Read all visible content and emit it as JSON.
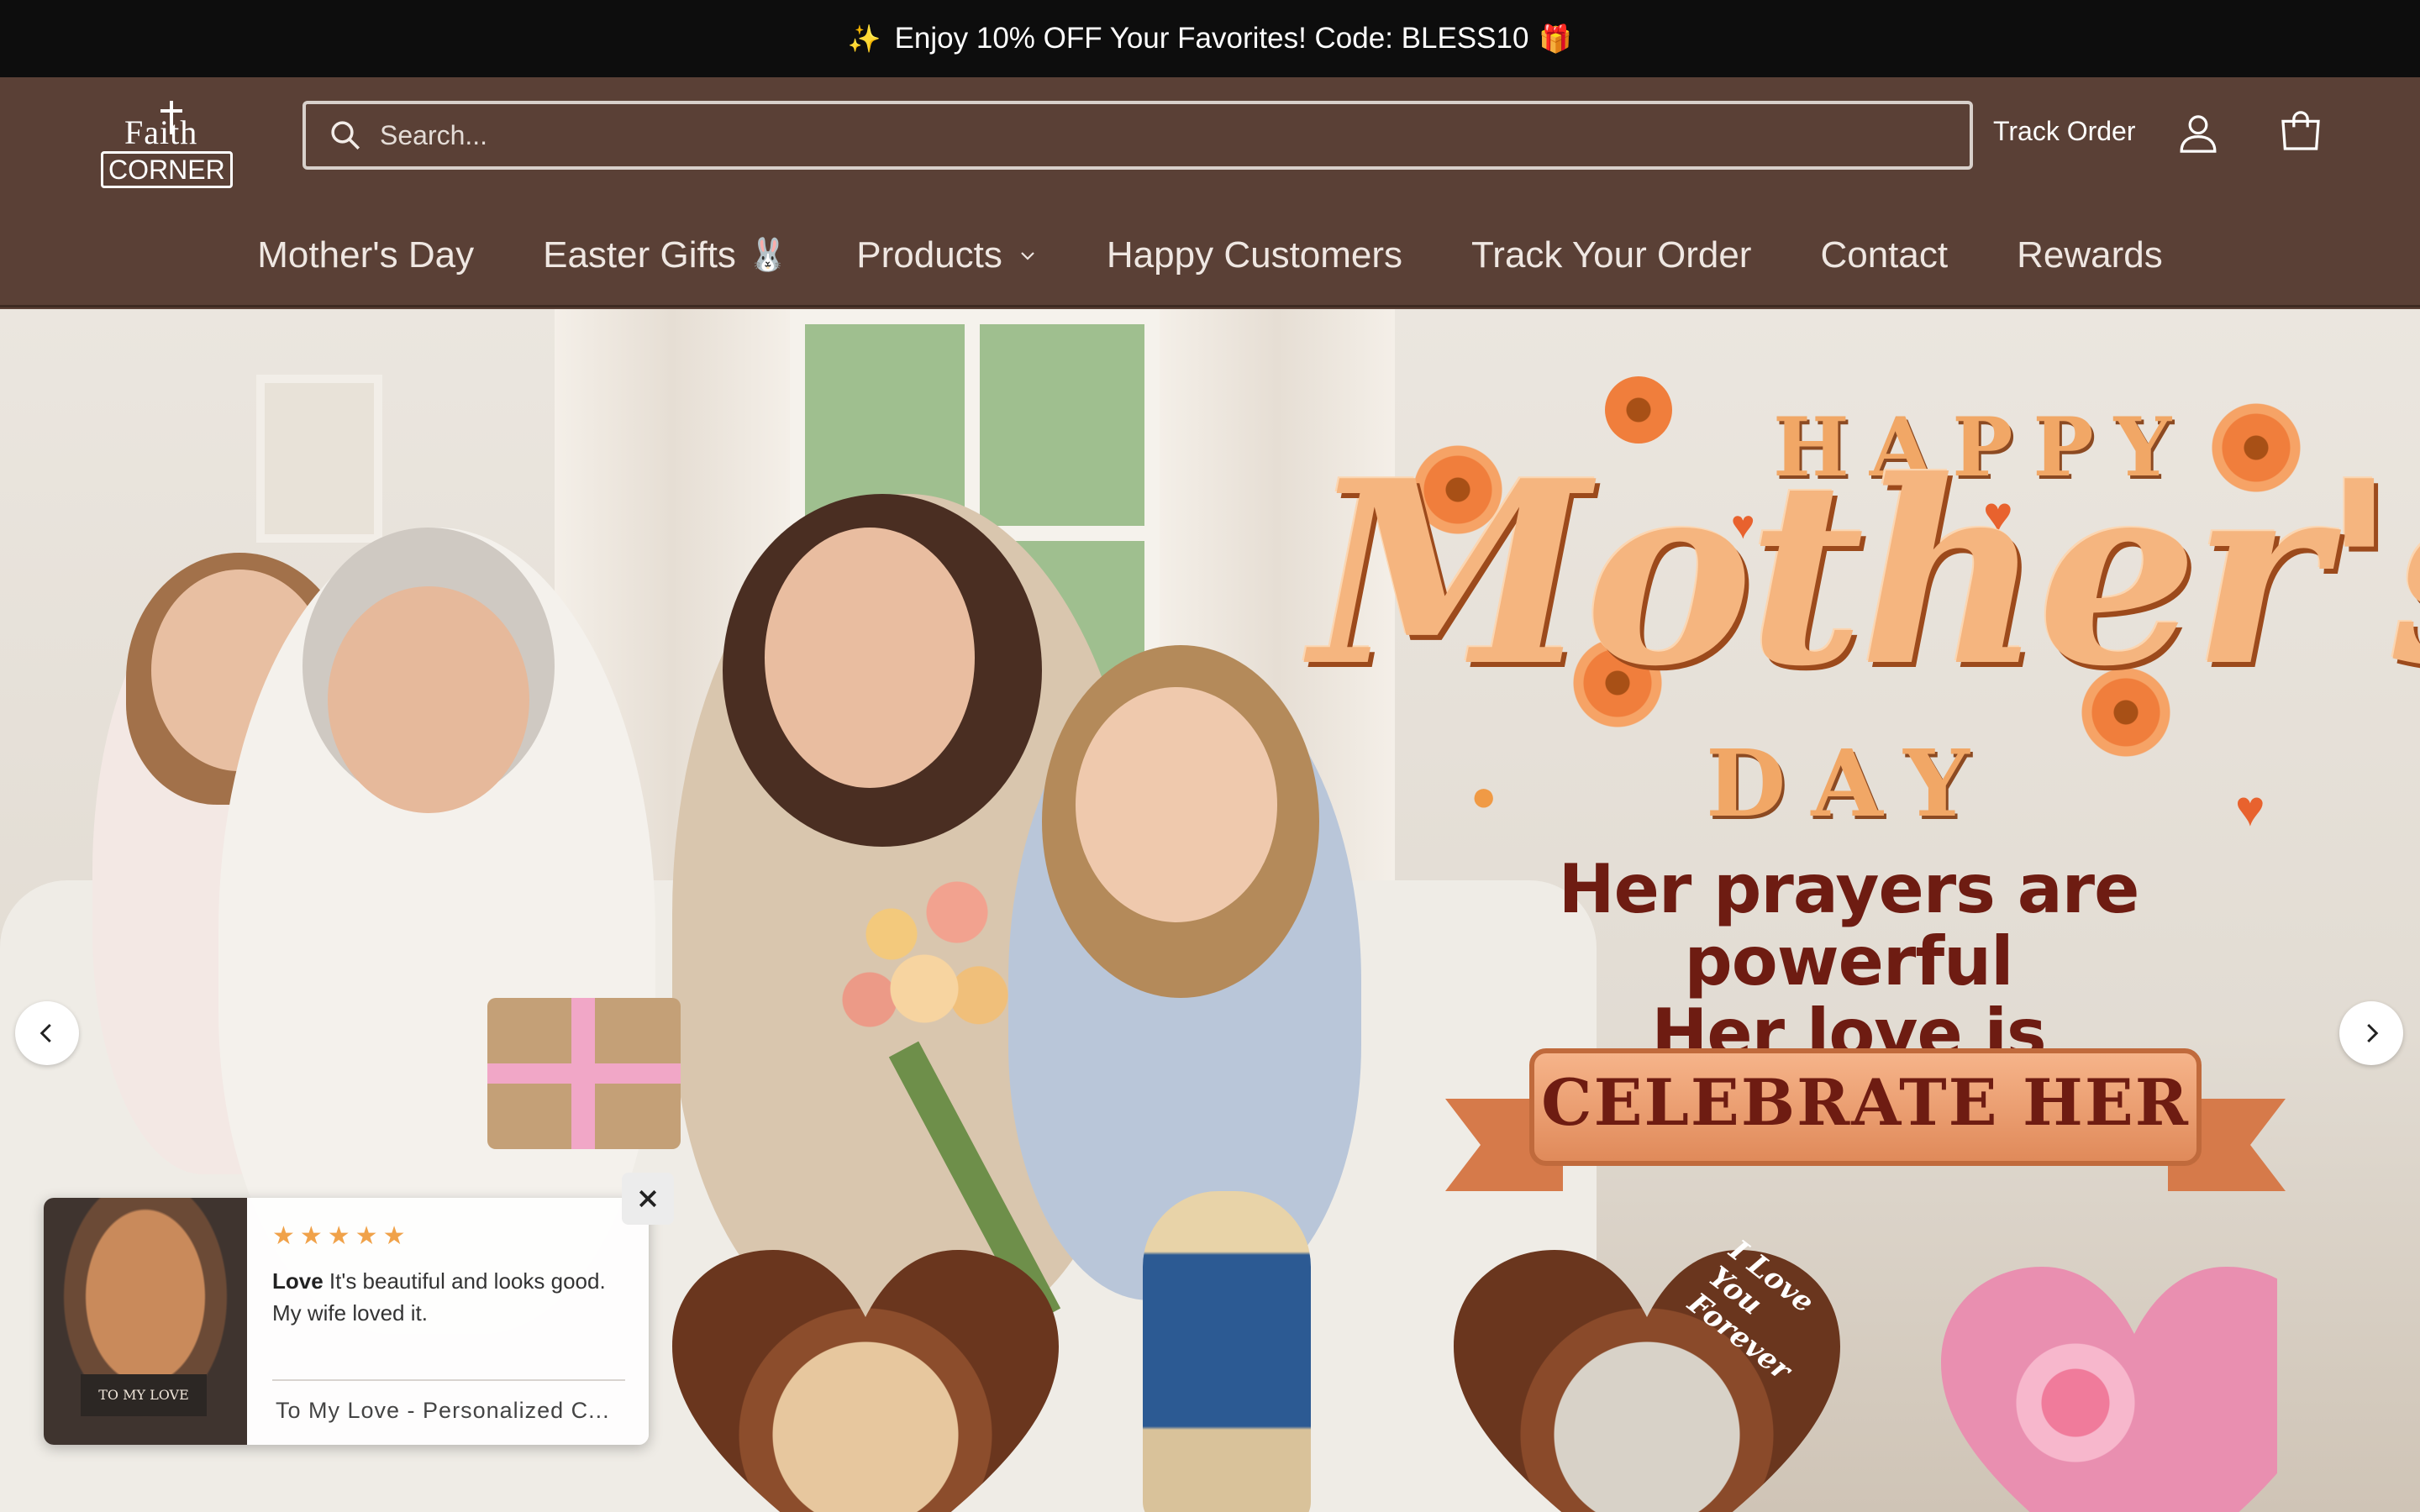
{
  "announcement": {
    "sparkle_icon": "sparkles-icon",
    "text": "Enjoy 10% OFF Your Favorites! Code: BLESS10",
    "gift_icon": "gift-icon"
  },
  "header": {
    "logo": {
      "line1": "Faith",
      "line2": "CORNER"
    },
    "search": {
      "placeholder": "Search..."
    },
    "track_order": "Track Order",
    "icons": {
      "account": "account-icon",
      "cart": "cart-icon"
    }
  },
  "nav": {
    "items": [
      {
        "label": "Mother's Day"
      },
      {
        "label": "Easter Gifts",
        "emoji": "🐰"
      },
      {
        "label": "Products",
        "has_dropdown": true
      },
      {
        "label": "Happy Customers"
      },
      {
        "label": "Track Your Order"
      },
      {
        "label": "Contact"
      },
      {
        "label": "Rewards"
      }
    ]
  },
  "hero": {
    "headline_top": "HAPPY",
    "headline_main": "Mother's",
    "headline_bottom": "DAY",
    "tagline_1": "Her prayers are powerful",
    "tagline_2": "Her love is unwavering",
    "cta": "CELEBRATE HER",
    "product_engraving": "I Love You Forever",
    "colors": {
      "accent": "#f07e3c",
      "text_dark": "#6e1c12",
      "header_bg": "#5a4036",
      "announce_bg": "#0d0d0d"
    }
  },
  "carousel": {
    "prev_icon": "chevron-left-icon",
    "next_icon": "chevron-right-icon"
  },
  "review_popup": {
    "rating": 5,
    "stars": "★★★★★",
    "author": "Love",
    "text": "It's beautiful and looks good. My wife loved it.",
    "product": "To My Love - Personalized C...",
    "thumb_caption": "TO MY LOVE",
    "close_icon": "close-icon"
  }
}
